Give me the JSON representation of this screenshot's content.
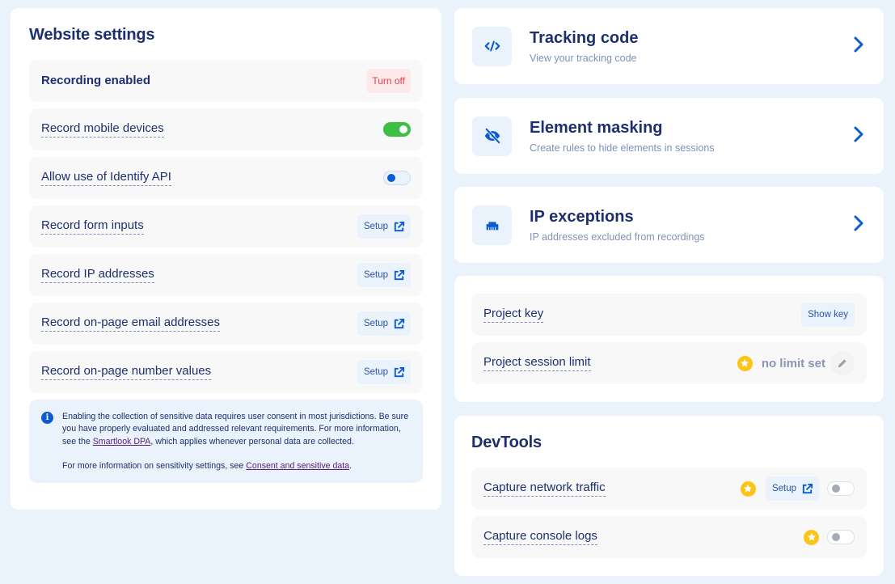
{
  "website_settings": {
    "title": "Website settings",
    "recording": {
      "label": "Recording enabled",
      "action": "Turn off"
    },
    "rows": [
      {
        "label": "Record mobile devices",
        "control": "toggle",
        "state": "on"
      },
      {
        "label": "Allow use of Identify API",
        "control": "toggle",
        "state": "off"
      },
      {
        "label": "Record form inputs",
        "control": "setup",
        "action": "Setup"
      },
      {
        "label": "Record IP addresses",
        "control": "setup",
        "action": "Setup"
      },
      {
        "label": "Record on-page email addresses",
        "control": "setup",
        "action": "Setup"
      },
      {
        "label": "Record on-page number values",
        "control": "setup",
        "action": "Setup"
      }
    ],
    "info": {
      "p1_before": "Enabling the collection of sensitive data requires user consent in most jurisdictions. Be sure you have properly evaluated and addressed relevant requirements. For more information, see the ",
      "p1_link": "Smartlook DPA",
      "p1_after": ", which applies whenever personal data are collected.",
      "p2_before": "For more information on sensitivity settings, see ",
      "p2_link": "Consent and sensitive data",
      "p2_after": "."
    }
  },
  "nav_cards": [
    {
      "title": "Tracking code",
      "subtitle": "View your tracking code",
      "icon": "code-icon"
    },
    {
      "title": "Element masking",
      "subtitle": "Create rules to hide elements in sessions",
      "icon": "eye-slash-icon"
    },
    {
      "title": "IP exceptions",
      "subtitle": "IP addresses excluded from recordings",
      "icon": "ethernet-icon"
    }
  ],
  "project": {
    "key_label": "Project key",
    "key_action": "Show key",
    "limit_label": "Project session limit",
    "limit_value": "no limit set"
  },
  "devtools": {
    "title": "DevTools",
    "rows": [
      {
        "label": "Capture network traffic",
        "action": "Setup",
        "state": "off",
        "premium": true
      },
      {
        "label": "Capture console logs",
        "state": "off",
        "premium": true
      }
    ]
  },
  "colors": {
    "accent": "#0b5bd3",
    "heading": "#1d2f6f",
    "toggle_on": "#3dbf45",
    "danger": "#e0424e",
    "premium": "#fcc419",
    "page_bg": "#eaf2fc"
  }
}
